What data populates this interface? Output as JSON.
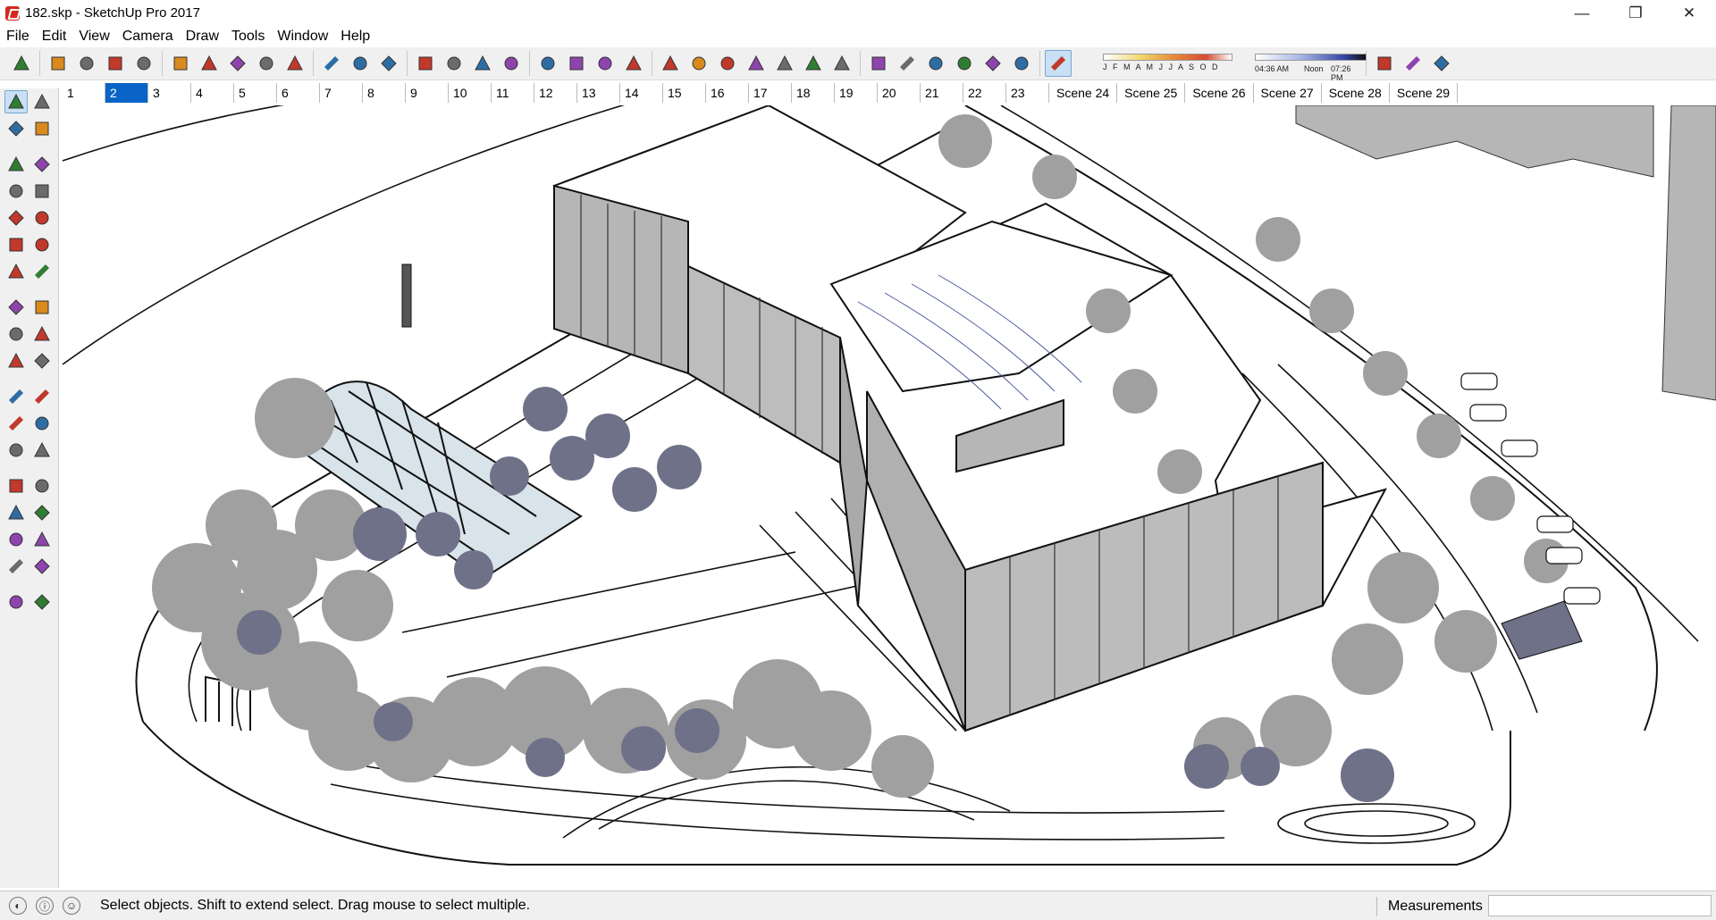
{
  "window": {
    "title": "182.skp - SketchUp Pro 2017",
    "minimize_glyph": "—",
    "restore_glyph": "❐",
    "close_glyph": "✕"
  },
  "menu": [
    "File",
    "Edit",
    "View",
    "Camera",
    "Draw",
    "Tools",
    "Window",
    "Help"
  ],
  "toolbar": {
    "icons": [
      "select-icon",
      "eraser-icon",
      "pencil-icon",
      "arc-icon",
      "rectangle-icon",
      "push-pull-icon",
      "follow-me-icon",
      "move-icon",
      "rotate-icon",
      "scale-icon",
      "tape-measure-icon",
      "text-icon",
      "paint-bucket-icon",
      "orbit-icon",
      "pan-icon",
      "zoom-icon",
      "zoom-extents-icon",
      "warehouse-icon",
      "extension-warehouse-icon",
      "send-to-layout-icon",
      "ruby-icon",
      "xray-icon",
      "back-edges-icon",
      "wireframe-icon",
      "hidden-line-icon",
      "shaded-icon",
      "shaded-textures-icon",
      "monochrome-icon",
      "iso-view-icon",
      "top-view-icon",
      "front-view-icon",
      "right-view-icon",
      "back-view-icon",
      "left-view-icon",
      "shadows-toggle-icon",
      "photo-texture-icon",
      "sandbox-icon",
      "add-location-icon"
    ],
    "shadow": {
      "months": "J F M A M J J A S O D",
      "time_start": "04:36 AM",
      "time_mid": "Noon",
      "time_end": "07:26 PM"
    }
  },
  "scenes": {
    "active_index": 1,
    "tabs": [
      "1",
      "2",
      "3",
      "4",
      "5",
      "6",
      "7",
      "8",
      "9",
      "10",
      "11",
      "12",
      "13",
      "14",
      "15",
      "16",
      "17",
      "18",
      "19",
      "20",
      "21",
      "22",
      "23",
      "Scene 24",
      "Scene 25",
      "Scene 26",
      "Scene 27",
      "Scene 28",
      "Scene 29"
    ]
  },
  "left_toolbar": {
    "rows": [
      [
        "select-icon",
        "component-icon"
      ],
      [
        "paint-bucket-icon",
        "eraser-icon"
      ],
      [
        "line-icon",
        "freehand-icon"
      ],
      [
        "rectangle-icon",
        "rotated-rectangle-icon"
      ],
      [
        "circle-icon",
        "polygon-icon"
      ],
      [
        "arc-icon",
        "two-point-arc-icon"
      ],
      [
        "three-point-arc-icon",
        "pie-icon"
      ],
      [
        "move-icon",
        "push-pull-icon"
      ],
      [
        "rotate-icon",
        "follow-me-icon"
      ],
      [
        "scale-icon",
        "offset-icon"
      ],
      [
        "tape-measure-icon",
        "dimension-icon"
      ],
      [
        "protractor-icon",
        "text-icon"
      ],
      [
        "axes-icon",
        "3d-text-icon"
      ],
      [
        "orbit-icon",
        "pan-icon"
      ],
      [
        "zoom-icon",
        "zoom-window-icon"
      ],
      [
        "zoom-extents-icon",
        "previous-view-icon"
      ],
      [
        "position-camera-icon",
        "look-around-icon"
      ],
      [
        "walk-icon",
        "section-plane-icon"
      ]
    ]
  },
  "status": {
    "hint": "Select objects. Shift to extend select. Drag mouse to select multiple.",
    "measurements_label": "Measurements",
    "measurements_value": ""
  },
  "colors": {
    "selected_tab": "#0a64c8",
    "tree_gray": "#a0a0a0",
    "tree_dark": "#6f7188",
    "building_gray": "#b6b6b6"
  }
}
